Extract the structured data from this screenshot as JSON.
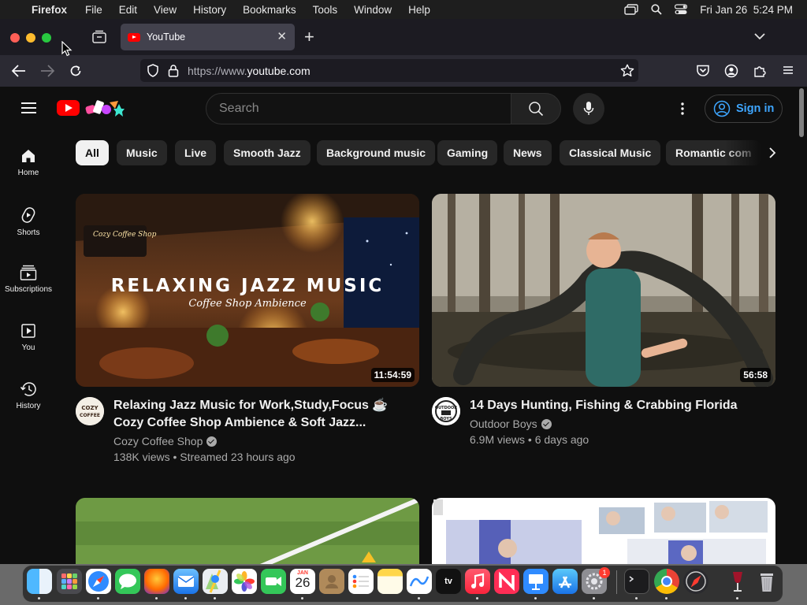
{
  "menubar": {
    "app": "Firefox",
    "items": [
      "File",
      "Edit",
      "View",
      "History",
      "Bookmarks",
      "Tools",
      "Window",
      "Help"
    ],
    "clock": "Fri Jan 26  5:24 PM"
  },
  "browser": {
    "tab_title": "YouTube",
    "url_prefix": "https://www.",
    "url_domain": "youtube.com"
  },
  "youtube": {
    "search_placeholder": "Search",
    "signin_label": "Sign in",
    "sidebar": [
      {
        "label": "Home",
        "icon": "home-icon"
      },
      {
        "label": "Shorts",
        "icon": "shorts-icon"
      },
      {
        "label": "Subscriptions",
        "icon": "subscriptions-icon"
      },
      {
        "label": "You",
        "icon": "you-icon"
      },
      {
        "label": "History",
        "icon": "history-icon"
      }
    ],
    "chips": [
      "All",
      "Music",
      "Live",
      "Smooth Jazz",
      "Background music",
      "Gaming",
      "News",
      "Classical Music",
      "Romantic com"
    ],
    "videos": [
      {
        "title_line1": "Relaxing Jazz Music for Work,Study,Focus ☕",
        "title_line2": "Cozy Coffee Shop Ambience & Soft Jazz...",
        "channel": "Cozy Coffee Shop",
        "meta": "138K views • Streamed 23 hours ago",
        "duration": "11:54:59",
        "thumb_headline": "RELAXING JAZZ MUSIC",
        "thumb_subline": "Coffee Shop Ambience",
        "avatar_text": "COZY COFFEE"
      },
      {
        "title_line1": "14 Days Hunting, Fishing & Crabbing Florida",
        "channel": "Outdoor Boys",
        "meta": "6.9M views • 6 days ago",
        "duration": "56:58",
        "avatar_text": "OUTDOOR BOYS"
      }
    ]
  },
  "dock": {
    "calendar_month": "JAN",
    "calendar_day": "26",
    "appstore_badge": "1",
    "tv_label": "tv"
  },
  "colors": {
    "youtube_red": "#ff0000",
    "link_blue": "#3ea6ff",
    "page_bg": "#0f0f0f"
  }
}
